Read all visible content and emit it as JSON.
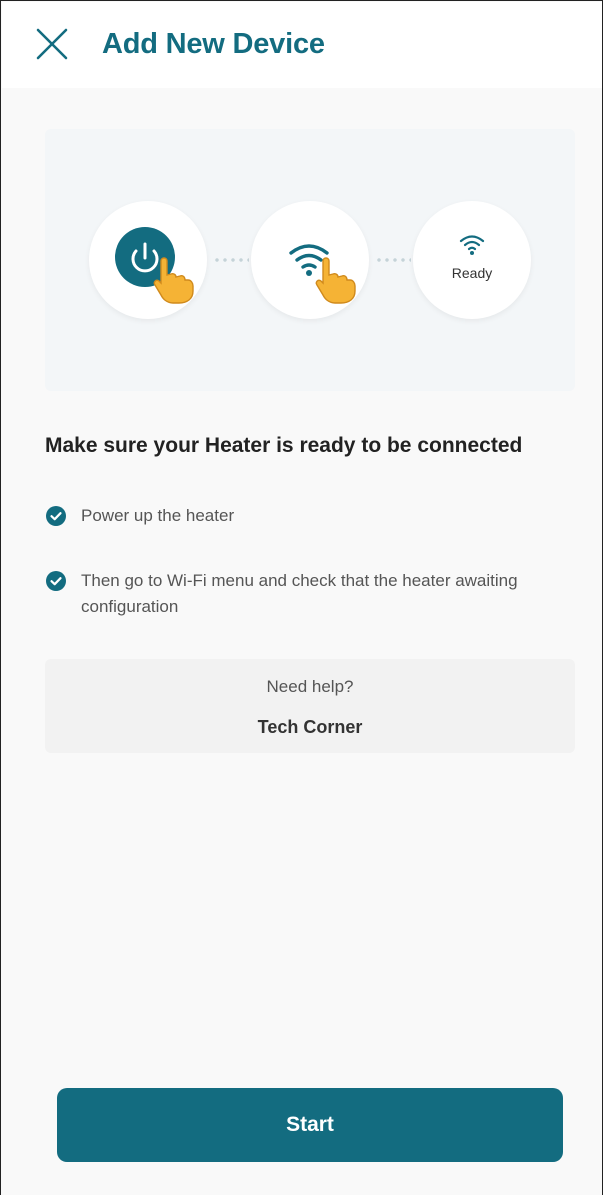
{
  "header": {
    "title": "Add New Device",
    "close_icon": "close-icon"
  },
  "illustration": {
    "steps": [
      {
        "icon": "power-icon",
        "gesture": "pointing-hand-icon"
      },
      {
        "icon": "wifi-icon",
        "gesture": "pointing-hand-icon"
      },
      {
        "icon": "wifi-icon",
        "label": "Ready"
      }
    ]
  },
  "instructions": {
    "heading": "Make sure your Heater is ready to be connected",
    "items": [
      {
        "text": "Power up the heater",
        "icon": "check-circle-icon"
      },
      {
        "text": "Then go to Wi-Fi menu and check that the heater awaiting configuration",
        "icon": "check-circle-icon"
      }
    ]
  },
  "help": {
    "question": "Need help?",
    "link_label": "Tech Corner"
  },
  "footer": {
    "start_label": "Start"
  },
  "colors": {
    "accent": "#136c80",
    "hand": "#f5b335",
    "text_dark": "#222222",
    "text_muted": "#555555"
  }
}
